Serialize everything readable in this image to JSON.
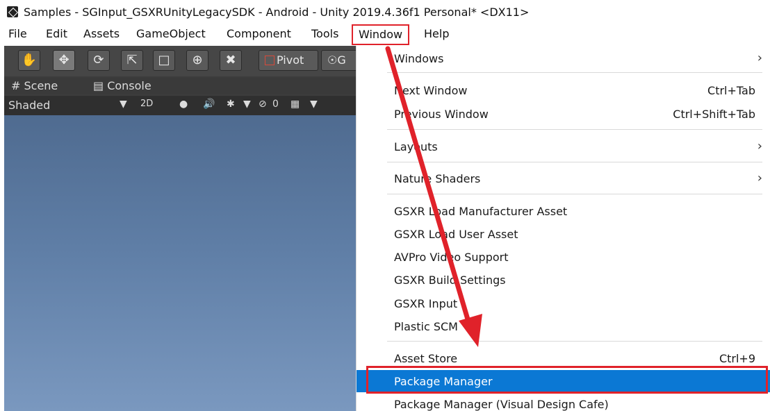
{
  "window": {
    "title": "Samples - SGInput_GSXRUnityLegacySDK - Android - Unity 2019.4.36f1 Personal* <DX11>"
  },
  "menubar": {
    "items": [
      "File",
      "Edit",
      "Assets",
      "GameObject",
      "Component",
      "Tools",
      "Window",
      "Help"
    ],
    "active": "Window"
  },
  "toolbar": {
    "tools": [
      "hand-tool-icon",
      "move-tool-icon",
      "rotate-tool-icon",
      "scale-tool-icon",
      "rect-tool-icon",
      "transform-tool-icon",
      "custom-tool-icon"
    ],
    "pivot_label": "Pivot",
    "global_label": "G"
  },
  "tabs": {
    "scene": "# Scene",
    "console": "Console"
  },
  "scenebar": {
    "shading_mode": "Shaded",
    "mode_2d": "2D",
    "hidden_count": "0"
  },
  "window_menu": {
    "items": [
      {
        "label": "Windows",
        "shortcut": "",
        "submenu": true
      },
      {
        "label": "Next Window",
        "shortcut": "Ctrl+Tab",
        "submenu": false
      },
      {
        "label": "Previous Window",
        "shortcut": "Ctrl+Shift+Tab",
        "submenu": false
      },
      {
        "label": "Layouts",
        "shortcut": "",
        "submenu": true
      },
      {
        "label": "Nature Shaders",
        "shortcut": "",
        "submenu": true
      },
      {
        "label": "GSXR Load Manufacturer Asset",
        "shortcut": "",
        "submenu": false
      },
      {
        "label": "GSXR Load User Asset",
        "shortcut": "",
        "submenu": false
      },
      {
        "label": "AVPro Video Support",
        "shortcut": "",
        "submenu": false
      },
      {
        "label": "GSXR Build Settings",
        "shortcut": "",
        "submenu": false
      },
      {
        "label": "GSXR Input",
        "shortcut": "",
        "submenu": false
      },
      {
        "label": "Plastic SCM",
        "shortcut": "",
        "submenu": false
      },
      {
        "label": "Asset Store",
        "shortcut": "Ctrl+9",
        "submenu": false
      },
      {
        "label": "Package Manager",
        "shortcut": "",
        "submenu": false
      },
      {
        "label": "Package Manager (Visual Design Cafe)",
        "shortcut": "",
        "submenu": false
      }
    ],
    "highlighted": "Package Manager"
  },
  "colors": {
    "highlight_blue": "#0b78d4",
    "annotation_red": "#e0222a"
  }
}
